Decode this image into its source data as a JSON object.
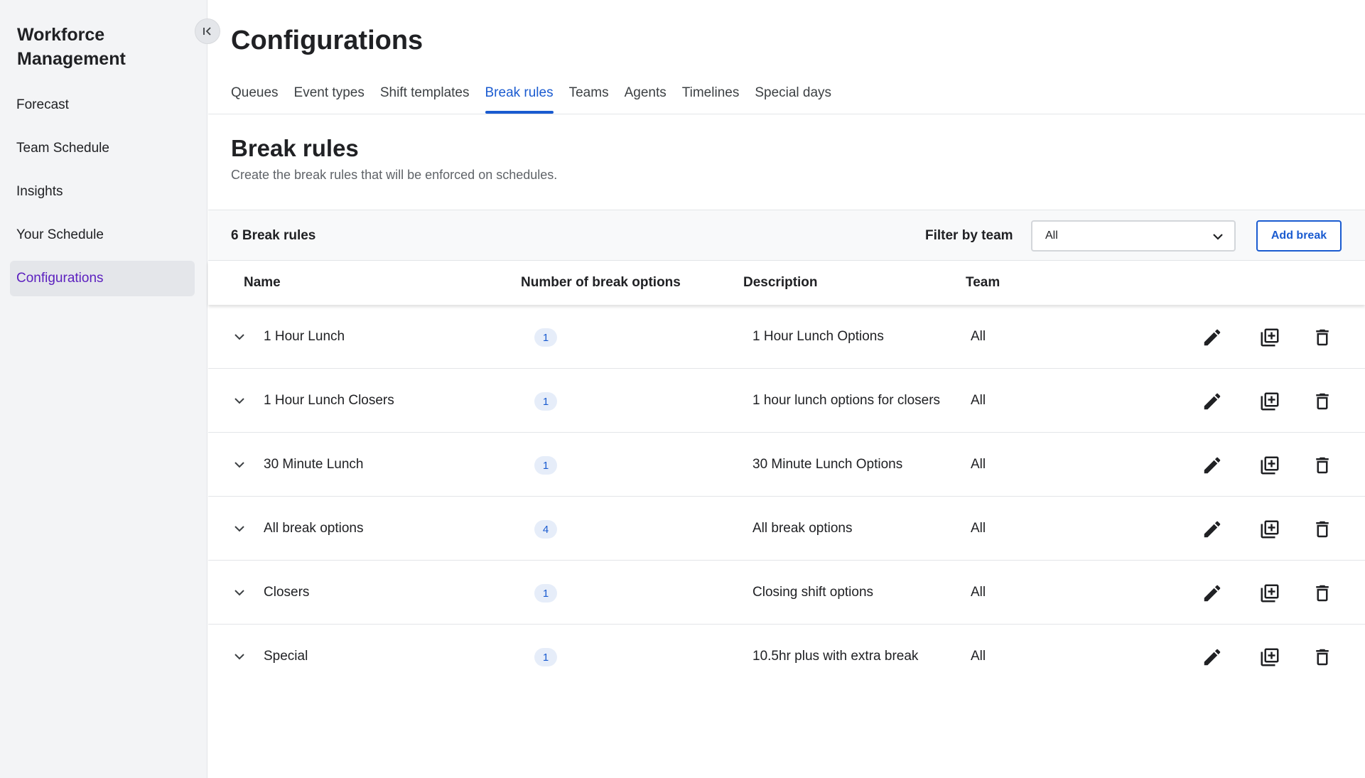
{
  "sidebar": {
    "title": "Workforce Management",
    "collapse_icon": "collapse-left-icon",
    "items": [
      {
        "label": "Forecast",
        "active": false
      },
      {
        "label": "Team Schedule",
        "active": false
      },
      {
        "label": "Insights",
        "active": false
      },
      {
        "label": "Your Schedule",
        "active": false
      },
      {
        "label": "Configurations",
        "active": true
      }
    ]
  },
  "header": {
    "title": "Configurations",
    "tabs": [
      {
        "label": "Queues",
        "active": false
      },
      {
        "label": "Event types",
        "active": false
      },
      {
        "label": "Shift templates",
        "active": false
      },
      {
        "label": "Break rules",
        "active": true
      },
      {
        "label": "Teams",
        "active": false
      },
      {
        "label": "Agents",
        "active": false
      },
      {
        "label": "Timelines",
        "active": false
      },
      {
        "label": "Special days",
        "active": false
      }
    ]
  },
  "section": {
    "title": "Break rules",
    "subtitle": "Create the break rules that will be enforced on schedules."
  },
  "toolbar": {
    "count_label": "6 Break rules",
    "filter_label": "Filter by team",
    "filter_value": "All",
    "add_label": "Add break"
  },
  "table": {
    "columns": {
      "name": "Name",
      "options": "Number of break options",
      "description": "Description",
      "team": "Team"
    },
    "rows": [
      {
        "name": "1 Hour Lunch",
        "options": "1",
        "description": "1 Hour Lunch Options",
        "team": "All"
      },
      {
        "name": "1 Hour Lunch Closers",
        "options": "1",
        "description": "1 hour lunch options for closers",
        "team": "All"
      },
      {
        "name": "30 Minute Lunch",
        "options": "1",
        "description": "30 Minute Lunch Options",
        "team": "All"
      },
      {
        "name": "All break options",
        "options": "4",
        "description": "All break options",
        "team": "All"
      },
      {
        "name": "Closers",
        "options": "1",
        "description": "Closing shift options",
        "team": "All"
      },
      {
        "name": "Special",
        "options": "1",
        "description": "10.5hr plus with extra break",
        "team": "All"
      }
    ],
    "row_icons": [
      "chevron-down-icon",
      "pencil-icon",
      "duplicate-icon",
      "trash-icon"
    ]
  },
  "colors": {
    "accent": "#1a5bd0",
    "nav_active_text": "#5b1fbf",
    "sidebar_bg": "#f3f4f6",
    "badge_bg": "#e6edf9"
  }
}
